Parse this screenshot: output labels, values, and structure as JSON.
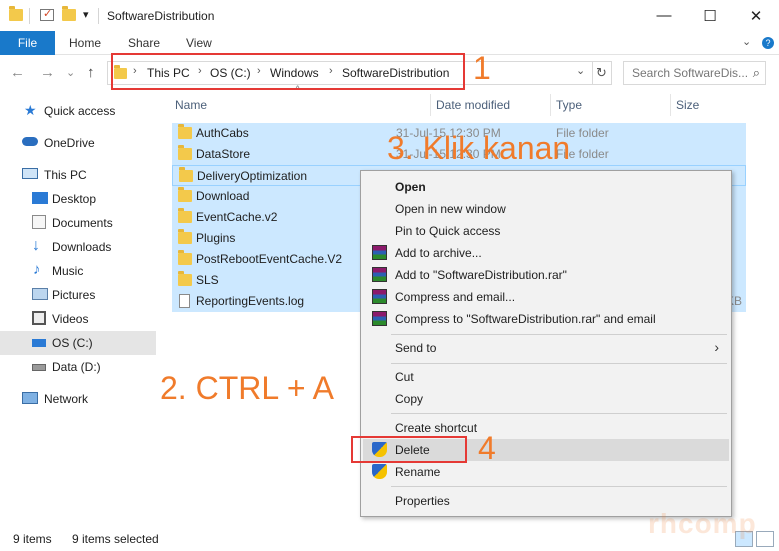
{
  "window": {
    "title": "SoftwareDistribution",
    "controls": {
      "minimize": "—",
      "maximize": "☐",
      "close": "✕"
    },
    "quick_access_toolbar_chevron": "▾"
  },
  "ribbon": {
    "file_tab": "File",
    "tabs": [
      "Home",
      "Share",
      "View"
    ],
    "collapse_glyph": "⌄",
    "help_glyph": "?"
  },
  "address": {
    "back": "←",
    "forward": "→",
    "recent": "⌄",
    "up": "↑",
    "crumbs": [
      "This PC",
      "OS (C:)",
      "Windows",
      "SoftwareDistribution"
    ],
    "separator": "›",
    "dropdown": "⌄",
    "refresh": "↻",
    "search_placeholder": "Search SoftwareDis...",
    "search_icon": "⌕"
  },
  "nav_pane": {
    "items": [
      {
        "label": "Quick access",
        "icon": "star-icon"
      },
      {
        "label": "OneDrive",
        "icon": "cloud-icon"
      },
      {
        "label": "This PC",
        "icon": "computer-icon"
      },
      {
        "label": "Desktop",
        "icon": "desktop-icon"
      },
      {
        "label": "Documents",
        "icon": "documents-icon"
      },
      {
        "label": "Downloads",
        "icon": "download-icon"
      },
      {
        "label": "Music",
        "icon": "music-icon"
      },
      {
        "label": "Pictures",
        "icon": "pictures-icon"
      },
      {
        "label": "Videos",
        "icon": "videos-icon"
      },
      {
        "label": "OS (C:)",
        "icon": "drive-icon"
      },
      {
        "label": "Data (D:)",
        "icon": "drive-icon"
      },
      {
        "label": "Network",
        "icon": "network-icon"
      }
    ]
  },
  "file_list": {
    "columns": {
      "name": "Name",
      "date_modified": "Date modified",
      "type": "Type",
      "size": "Size"
    },
    "sort_glyph": "^",
    "rows": [
      {
        "name": "AuthCabs",
        "date": "31-Jul-15 12:30 PM",
        "type": "File folder",
        "size": ""
      },
      {
        "name": "DataStore",
        "date": "31-Jul-15 12:30 PM",
        "type": "File folder",
        "size": ""
      },
      {
        "name": "DeliveryOptimization",
        "date": "",
        "type": "",
        "size": ""
      },
      {
        "name": "Download",
        "date": "",
        "type": "",
        "size": ""
      },
      {
        "name": "EventCache.v2",
        "date": "",
        "type": "",
        "size": ""
      },
      {
        "name": "Plugins",
        "date": "",
        "type": "",
        "size": ""
      },
      {
        "name": "PostRebootEventCache.V2",
        "date": "",
        "type": "",
        "size": ""
      },
      {
        "name": "SLS",
        "date": "",
        "type": "",
        "size": ""
      },
      {
        "name": "ReportingEvents.log",
        "date": "",
        "type": "",
        "size": "KB"
      }
    ]
  },
  "context_menu": {
    "open": "Open",
    "open_new_window": "Open in new window",
    "pin_quick_access": "Pin to Quick access",
    "add_archive": "Add to archive...",
    "add_rar": "Add to \"SoftwareDistribution.rar\"",
    "compress_email": "Compress and email...",
    "compress_rar_email": "Compress to \"SoftwareDistribution.rar\" and email",
    "send_to": "Send to",
    "submenu_arrow": "›",
    "cut": "Cut",
    "copy": "Copy",
    "create_shortcut": "Create shortcut",
    "delete": "Delete",
    "rename": "Rename",
    "properties": "Properties"
  },
  "status_bar": {
    "item_count": "9 items",
    "selection": "9 items selected"
  },
  "annotations": {
    "step1": "1",
    "step2": "2. CTRL + A",
    "step3": "3. Klik kanan",
    "step4": "4",
    "watermark": "rhcomp",
    "color_text": "#f07b2b",
    "color_box": "#e53935"
  },
  "colors": {
    "accent": "#1979ca",
    "selection": "#cce8ff",
    "folder": "#f3c94b"
  }
}
